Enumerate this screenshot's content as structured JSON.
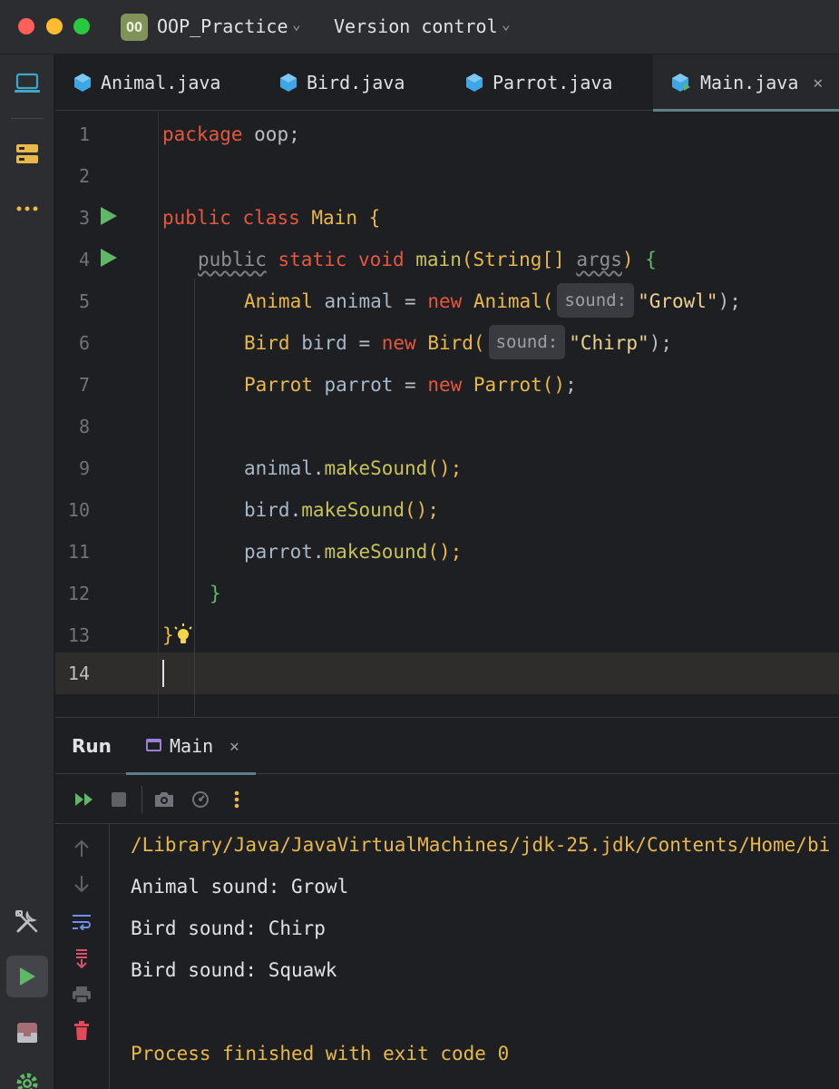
{
  "titlebar": {
    "project_badge": "OO",
    "project_name": "OOP_Practice",
    "vcs_label": "Version control"
  },
  "left_strip": {
    "icons": [
      "project-view-icon",
      "structure-icon",
      "more-tools-icon",
      "build-tools-icon",
      "run-icon",
      "terminal-icon",
      "settings-icon"
    ]
  },
  "tabs": [
    {
      "label": "Animal.java",
      "active": false
    },
    {
      "label": "Bird.java",
      "active": false
    },
    {
      "label": "Parrot.java",
      "active": false
    },
    {
      "label": "Main.java",
      "active": true
    }
  ],
  "editor": {
    "line_numbers": [
      "1",
      "2",
      "3",
      "4",
      "5",
      "6",
      "7",
      "8",
      "9",
      "10",
      "11",
      "12",
      "13",
      "14"
    ],
    "current_line": "14",
    "hints": {
      "animal_param": "sound:",
      "bird_param": "sound:"
    },
    "code": {
      "l1_kw": "package",
      "l1_rest": " oop;",
      "l3_public": "public",
      "l3_class": "class",
      "l3_name": "Main",
      "l3_brace": "{",
      "l4_public": "public",
      "l4_static": "static",
      "l4_void": "void",
      "l4_main": "main",
      "l4_open": "(",
      "l4_type": "String[]",
      "l4_args": "args",
      "l4_close": ")",
      "l4_brace": "{",
      "l5_type": "Animal",
      "l5_var": "animal",
      "l5_eq": " = ",
      "l5_new": "new",
      "l5_ctor": "Animal(",
      "l5_str": "\"Growl\"",
      "l5_end": ");",
      "l6_type": "Bird",
      "l6_var": "bird",
      "l6_eq": " = ",
      "l6_new": "new",
      "l6_ctor": "Bird(",
      "l6_str": "\"Chirp\"",
      "l6_end": ");",
      "l7_type": "Parrot",
      "l7_var": "parrot",
      "l7_eq": " = ",
      "l7_new": "new",
      "l7_ctor": "Parrot()",
      "l7_end": ";",
      "l9_obj": "animal",
      "l9_call": "makeSound",
      "l9_end": "();",
      "l10_obj": "bird",
      "l10_call": "makeSound",
      "l10_end": "();",
      "l11_obj": "parrot",
      "l11_call": "makeSound",
      "l11_end": "();",
      "l12": "}",
      "l13": "}"
    }
  },
  "run_window": {
    "title": "Run",
    "tab_label": "Main",
    "toolbar_icons": [
      "rerun-icon",
      "stop-icon",
      "screenshot-icon",
      "profiler-icon",
      "more-icon"
    ],
    "side_icons": [
      "scroll-up-icon",
      "scroll-down-icon",
      "soft-wrap-icon",
      "scroll-to-end-icon",
      "print-icon",
      "clear-icon"
    ],
    "output": [
      "/Library/Java/JavaVirtualMachines/jdk-25.jdk/Contents/Home/bi",
      "Animal sound: Growl",
      "Bird sound: Chirp",
      "Bird sound: Squawk",
      "",
      "Process finished with exit code 0"
    ]
  },
  "colors": {
    "background": "#1e1f22",
    "keyword": "#e6573d",
    "type": "#e8b84a",
    "string": "#ecd08c",
    "run_green": "#5fb865",
    "accent_tab": "#5d8086"
  }
}
